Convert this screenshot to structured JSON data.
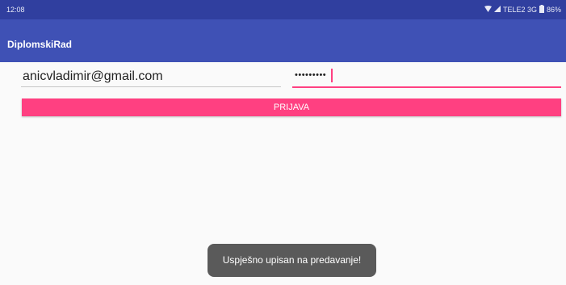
{
  "status_bar": {
    "time": "12:08",
    "carrier": "TELE2 3G",
    "battery": "86%",
    "icons": [
      "wifi-icon",
      "signal-icon",
      "battery-icon"
    ]
  },
  "app_bar": {
    "title": "DiplomskiRad",
    "color": "#3f51b5"
  },
  "form": {
    "email_value": "anicvladimir@gmail.com",
    "password_value": "•••••••••",
    "accent_color": "#ff4081"
  },
  "login_button": {
    "label": "PRIJAVA"
  },
  "toast": {
    "message": "Uspješno upisan na predavanje!"
  }
}
